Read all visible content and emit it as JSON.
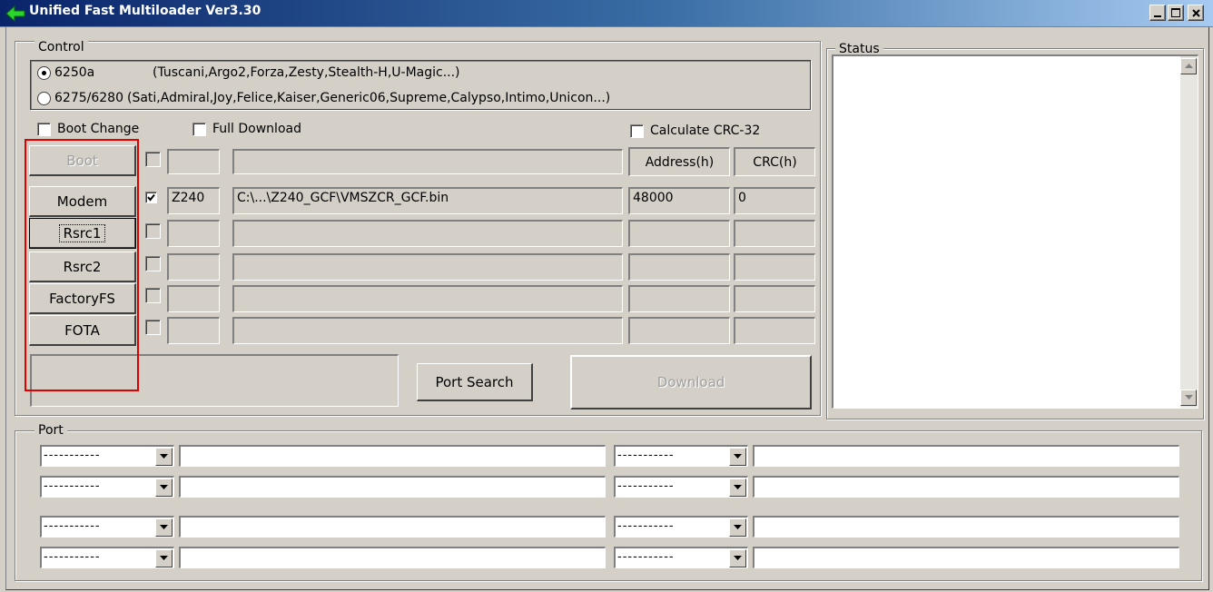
{
  "window": {
    "title": "Unified Fast Multiloader Ver3.30"
  },
  "control": {
    "legend": "Control",
    "chipset_options": [
      {
        "id": "6250a",
        "label": "6250a",
        "devices": "(Tuscani,Argo2,Forza,Zesty,Stealth-H,U-Magic...)",
        "selected": true
      },
      {
        "id": "6275",
        "label": "6275/6280",
        "devices": "(Sati,Admiral,Joy,Felice,Kaiser,Generic06,Supreme,Calypso,Intimo,Unicon...)",
        "selected": false
      }
    ],
    "boot_change": {
      "label": "Boot Change",
      "checked": false
    },
    "full_download": {
      "label": "Full Download",
      "checked": false
    },
    "calc_crc": {
      "label": "Calculate CRC-32",
      "checked": false
    },
    "headers": {
      "address": "Address(h)",
      "crc": "CRC(h)"
    },
    "rows": [
      {
        "button": "Boot",
        "enabled": false,
        "checked": false,
        "model": "",
        "path": "",
        "address": "",
        "crc": ""
      },
      {
        "button": "Modem",
        "enabled": true,
        "checked": true,
        "model": "Z240",
        "path": "C:\\...\\Z240_GCF\\VMSZCR_GCF.bin",
        "address": "48000",
        "crc": "0"
      },
      {
        "button": "Rsrc1",
        "enabled": true,
        "checked": false,
        "model": "",
        "path": "",
        "address": "",
        "crc": ""
      },
      {
        "button": "Rsrc2",
        "enabled": true,
        "checked": false,
        "model": "",
        "path": "",
        "address": "",
        "crc": ""
      },
      {
        "button": "FactoryFS",
        "enabled": true,
        "checked": false,
        "model": "",
        "path": "",
        "address": "",
        "crc": ""
      },
      {
        "button": "FOTA",
        "enabled": true,
        "checked": false,
        "model": "",
        "path": "",
        "address": "",
        "crc": ""
      }
    ],
    "port_search_label": "Port Search",
    "download_label": "Download",
    "message": ""
  },
  "status": {
    "legend": "Status",
    "text": ""
  },
  "port": {
    "legend": "Port",
    "slots": [
      {
        "value": "-----------",
        "info": ""
      },
      {
        "value": "-----------",
        "info": ""
      },
      {
        "value": "-----------",
        "info": ""
      },
      {
        "value": "-----------",
        "info": ""
      },
      {
        "value": "-----------",
        "info": ""
      },
      {
        "value": "-----------",
        "info": ""
      },
      {
        "value": "-----------",
        "info": ""
      },
      {
        "value": "-----------",
        "info": ""
      }
    ]
  },
  "colors": {
    "titlebar": "#0a246a",
    "face": "#d4d0c8",
    "highlight_box": "#e00000"
  }
}
